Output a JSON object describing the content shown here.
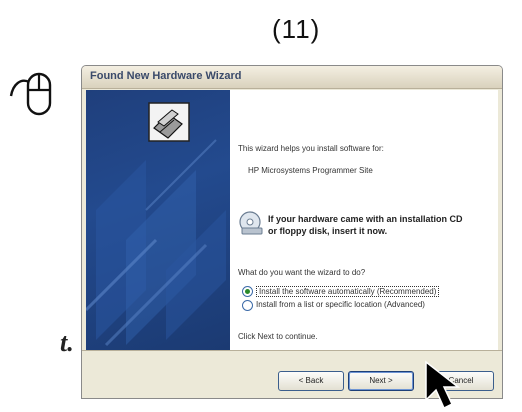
{
  "step": "(11)",
  "side_fragment": "t.",
  "window": {
    "title": "Found New Hardware Wizard",
    "intro": "This wizard helps you install software for:",
    "device": "HP Microsystems Programmer Site",
    "cd_notice_line1": "If your hardware came with an installation CD",
    "cd_notice_line2": "or floppy disk, insert it now.",
    "question": "What do you want the wizard to do?",
    "options": [
      {
        "label": "Install the software automatically (Recommended)",
        "selected": true
      },
      {
        "label": "Install from a list or specific location (Advanced)",
        "selected": false
      }
    ],
    "continue_text": "Click Next to continue.",
    "buttons": {
      "back": "< Back",
      "next": "Next >",
      "cancel": "Cancel"
    }
  }
}
